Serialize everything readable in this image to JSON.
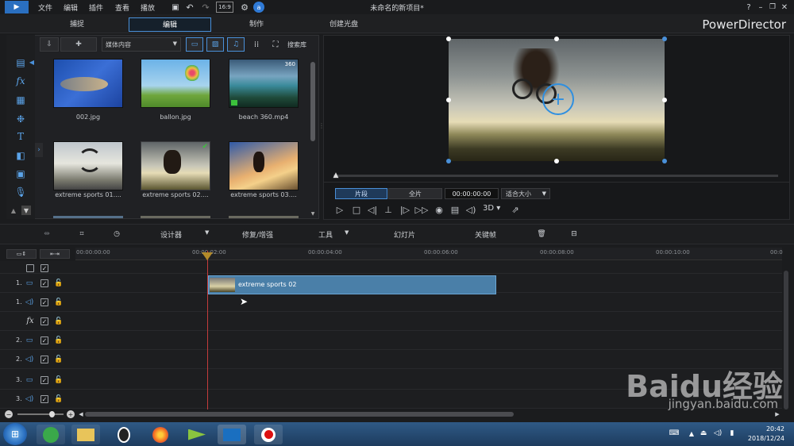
{
  "titlebar": {
    "menus": [
      "文件",
      "编辑",
      "插件",
      "查看",
      "播放"
    ],
    "title": "未命名的新项目*"
  },
  "modes": {
    "capture": "捕捉",
    "edit": "编辑",
    "produce": "制作",
    "disc": "创建光盘",
    "brand": "PowerDirector"
  },
  "library": {
    "dropdown": "媒体内容",
    "search": "搜索库",
    "items": [
      {
        "name": "002.jpg"
      },
      {
        "name": "ballon.jpg"
      },
      {
        "name": "beach 360.mp4"
      },
      {
        "name": "extreme sports 01...."
      },
      {
        "name": "extreme sports 02...."
      },
      {
        "name": "extreme sports 03...."
      }
    ],
    "badge360": "360"
  },
  "preview": {
    "segment": "片段",
    "full": "全片",
    "timecode": "00:00:00:00",
    "fit": "适合大小",
    "mode3d": "3D"
  },
  "edit_toolbar": {
    "designer": "设计器",
    "fix": "修复/增强",
    "tools": "工具",
    "slideshow": "幻灯片",
    "keyframe": "关键帧"
  },
  "ruler": {
    "ticks": [
      "00:00:00:00",
      "00:00:02:00",
      "00:00:04:00",
      "00:00:06:00",
      "00:00:08:00",
      "00:00:10:00",
      "00:0"
    ]
  },
  "tracks": [
    {
      "num": "1."
    },
    {
      "num": "1."
    },
    {
      "num": ""
    },
    {
      "num": "2."
    },
    {
      "num": "2."
    },
    {
      "num": "3."
    },
    {
      "num": "3."
    }
  ],
  "clip": {
    "label": "extreme sports 02"
  },
  "taskbar": {
    "time": "20:42",
    "date": "2018/12/24"
  },
  "watermark": {
    "main": "Baidu经验",
    "sub": "jingyan.baidu.com"
  },
  "colors": {
    "accent": "#4a90d9",
    "clip": "#4a7fa8",
    "playhead": "#c43c3c"
  }
}
